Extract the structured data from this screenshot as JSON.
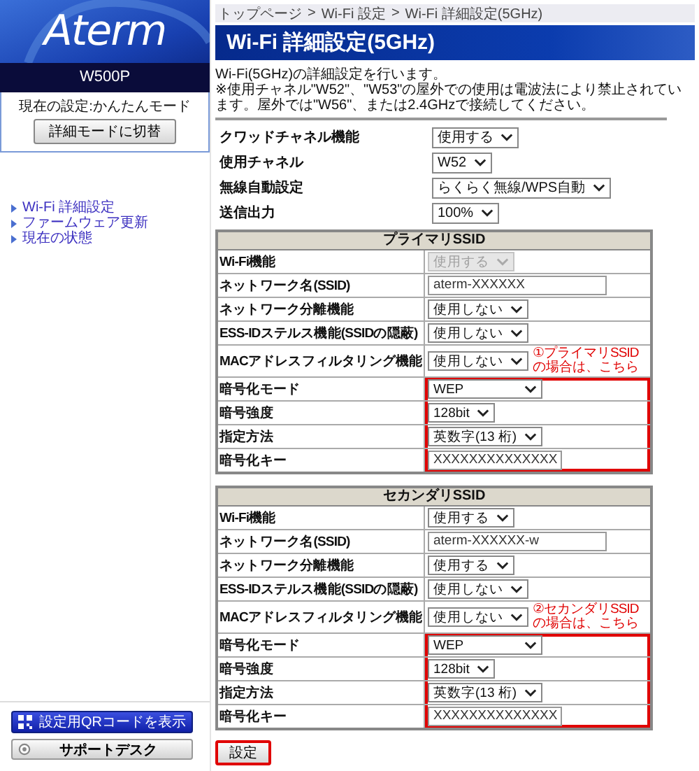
{
  "sidebar": {
    "logo": "Aterm",
    "model": "W500P",
    "current_mode": "現在の設定:かんたんモード",
    "switch_button": "詳細モードに切替",
    "nav": [
      "Wi-Fi 詳細設定",
      "ファームウェア更新",
      "現在の状態"
    ],
    "qr_button": "設定用QRコードを表示",
    "support_button": "サポートデスク"
  },
  "breadcrumb": {
    "items": [
      "トップページ",
      "Wi-Fi 設定",
      "Wi-Fi 詳細設定(5GHz)"
    ],
    "separator": ">"
  },
  "title": "Wi-Fi 詳細設定(5GHz)",
  "description": [
    "Wi-Fi(5GHz)の詳細設定を行います。",
    "※使用チャネル\"W52\"、\"W53\"の屋外での使用は電波法により禁止されています。屋外では\"W56\"、または2.4GHzで接続してください。"
  ],
  "settings": [
    {
      "label": "クワッドチャネル機能",
      "value": "使用する",
      "kind": "select"
    },
    {
      "label": "使用チャネル",
      "value": "W52",
      "kind": "select"
    },
    {
      "label": "無線自動設定",
      "value": "らくらく無線/WPS自動",
      "kind": "select"
    },
    {
      "label": "送信出力",
      "value": "100%",
      "kind": "select"
    }
  ],
  "ssid_tables": [
    {
      "title": "プライマリSSID",
      "rows": [
        {
          "label": "Wi-Fi機能",
          "kind": "select",
          "value": "使用する",
          "disabled": true,
          "highlighted": false
        },
        {
          "label": "ネットワーク名(SSID)",
          "kind": "text",
          "value": "aterm-XXXXXX",
          "highlighted": false
        },
        {
          "label": "ネットワーク分離機能",
          "kind": "select",
          "value": "使用しない",
          "disabled": false,
          "highlighted": false
        },
        {
          "label": "ESS-IDステルス機能(SSIDの隠蔽)",
          "kind": "select",
          "value": "使用しない",
          "disabled": false,
          "highlighted": false
        },
        {
          "label": "MACアドレスフィルタリング機能",
          "kind": "select",
          "value": "使用しない",
          "disabled": false,
          "highlighted": false,
          "note": "①プライマリSSIDの場合は、こちら"
        },
        {
          "label": "暗号化モード",
          "kind": "select",
          "value": "WEP",
          "disabled": false,
          "highlighted": true
        },
        {
          "label": "暗号強度",
          "kind": "select",
          "value": "128bit",
          "disabled": false,
          "highlighted": true
        },
        {
          "label": "指定方法",
          "kind": "select",
          "value": "英数字(13 桁)",
          "disabled": false,
          "highlighted": true
        },
        {
          "label": "暗号化キー",
          "kind": "text",
          "value": "XXXXXXXXXXXXXX",
          "highlighted": true
        }
      ]
    },
    {
      "title": "セカンダリSSID",
      "rows": [
        {
          "label": "Wi-Fi機能",
          "kind": "select",
          "value": "使用する",
          "disabled": false,
          "highlighted": false
        },
        {
          "label": "ネットワーク名(SSID)",
          "kind": "text",
          "value": "aterm-XXXXXX-w",
          "highlighted": false
        },
        {
          "label": "ネットワーク分離機能",
          "kind": "select",
          "value": "使用する",
          "disabled": false,
          "highlighted": false
        },
        {
          "label": "ESS-IDステルス機能(SSIDの隠蔽)",
          "kind": "select",
          "value": "使用しない",
          "disabled": false,
          "highlighted": false
        },
        {
          "label": "MACアドレスフィルタリング機能",
          "kind": "select",
          "value": "使用しない",
          "disabled": false,
          "highlighted": false,
          "note": "②セカンダリSSIDの場合は、こちら"
        },
        {
          "label": "暗号化モード",
          "kind": "select",
          "value": "WEP",
          "disabled": false,
          "highlighted": true
        },
        {
          "label": "暗号強度",
          "kind": "select",
          "value": "128bit",
          "disabled": false,
          "highlighted": true
        },
        {
          "label": "指定方法",
          "kind": "select",
          "value": "英数字(13 桁)",
          "disabled": false,
          "highlighted": true
        },
        {
          "label": "暗号化キー",
          "kind": "text",
          "value": "XXXXXXXXXXXXXX",
          "highlighted": true
        }
      ]
    }
  ],
  "submit": {
    "label": "設定",
    "highlighted": true
  }
}
